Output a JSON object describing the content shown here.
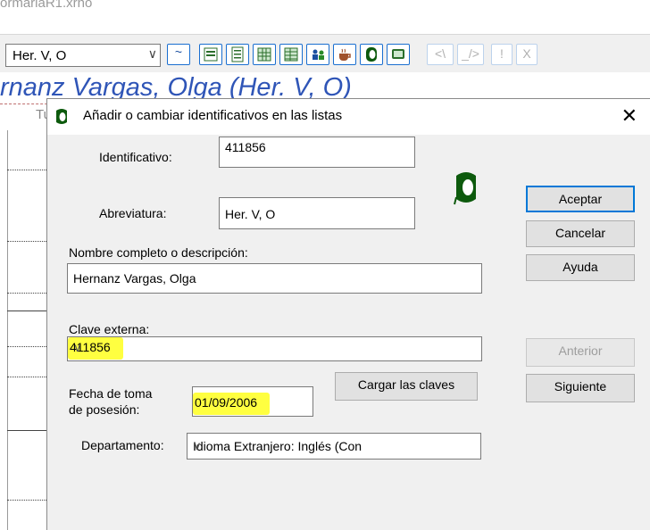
{
  "background": {
    "window_title": "ormariaR1.xrho",
    "combo_value": "Her. V, O",
    "combo_arrow": "∨",
    "name_header": "rnanz Vargas, Olga (Her. V, O)",
    "column_header": "Tu",
    "toolbar_buttons": [
      {
        "name": "toggle-button",
        "glyph": "~"
      },
      {
        "name": "list-view-icon",
        "glyph": ""
      },
      {
        "name": "document-icon",
        "glyph": ""
      },
      {
        "name": "grid-icon",
        "glyph": ""
      },
      {
        "name": "table-icon",
        "glyph": ""
      },
      {
        "name": "people-icon",
        "glyph": ""
      },
      {
        "name": "cup-icon",
        "glyph": ""
      },
      {
        "name": "person-icon",
        "glyph": ""
      },
      {
        "name": "monitor-icon",
        "glyph": ""
      }
    ],
    "disabled_buttons": [
      "<\\",
      "_/>",
      "!",
      "X"
    ]
  },
  "dialog": {
    "title": "Añadir o cambiar identificativos en las listas",
    "close_glyph": "✕",
    "labels": {
      "identificativo": "Identificativo:",
      "abreviatura": "Abreviatura:",
      "nombre": "Nombre completo o descripción:",
      "clave_externa": "Clave externa:",
      "fecha_line1": "Fecha de toma",
      "fecha_line2": "de posesión:",
      "departamento": "Departamento:"
    },
    "values": {
      "identificativo": "411856",
      "abreviatura": "Her. V, O",
      "nombre": "Hernanz Vargas, Olga",
      "clave_externa": "411856",
      "fecha": "01/09/2006",
      "departamento": "Idioma Extranjero: Inglés (Con"
    },
    "dropdown_glyph": "∨",
    "buttons": {
      "aceptar": "Aceptar",
      "cancelar": "Cancelar",
      "ayuda": "Ayuda",
      "cargar": "Cargar las claves",
      "anterior": "Anterior",
      "siguiente": "Siguiente"
    },
    "colors": {
      "highlight": "#ffff40",
      "accent": "#0078d7",
      "header_text": "#2f55b7"
    }
  }
}
